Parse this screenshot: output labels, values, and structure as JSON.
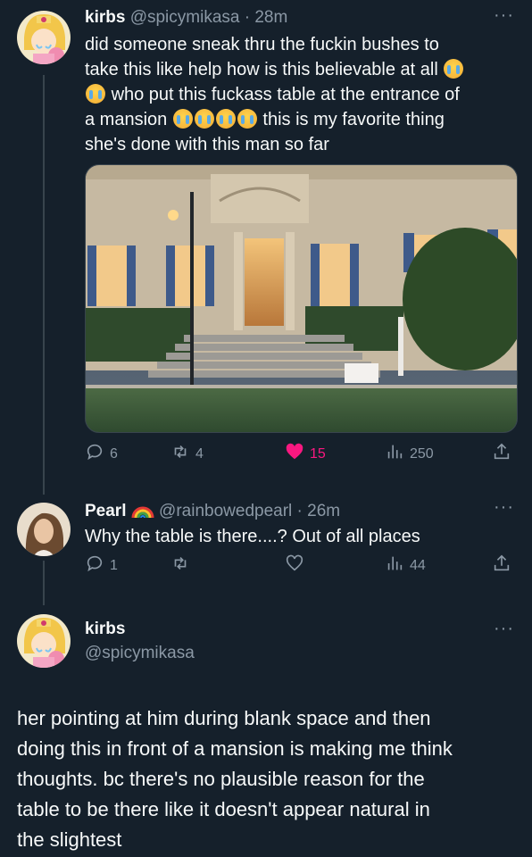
{
  "tweets": [
    {
      "name": "kirbs",
      "handle": "@spicymikasa",
      "time": "28m",
      "text_lines": [
        "did someone sneak thru the fuckin bushes to",
        "take this like help how is this believable at all",
        "who put this fuckass table at the entrance of",
        "a mansion",
        "this is my favorite thing",
        "she's done with this man so far"
      ],
      "replies": "6",
      "reposts": "4",
      "likes": "15",
      "views": "250"
    },
    {
      "name": "Pearl",
      "handle": "@rainbowedpearl",
      "time": "26m",
      "text": "Why the table is there....? Out of all places",
      "replies": "1",
      "reposts": "",
      "likes": "",
      "views": "44"
    },
    {
      "name": "kirbs",
      "handle": "@spicymikasa",
      "text_lines": [
        "her pointing at him during blank space and then",
        "doing this in front of a mansion is making me think",
        "thoughts. bc there's no plausible reason for the",
        "table to be there like it doesn't appear natural in",
        "the slightest"
      ]
    }
  ],
  "icons": {
    "reply": "speech-bubble-icon",
    "repost": "repost-arrows-icon",
    "like": "heart-icon",
    "views": "bar-chart-icon",
    "share": "share-upload-icon",
    "more": "more-dots-icon",
    "emoji": "loudly-crying-face-emoji",
    "rainbow": "rainbow-emoji"
  },
  "colors": {
    "background": "#15202b",
    "text": "#f7f9f9",
    "secondary": "#8b98a5",
    "like": "#f91880"
  }
}
